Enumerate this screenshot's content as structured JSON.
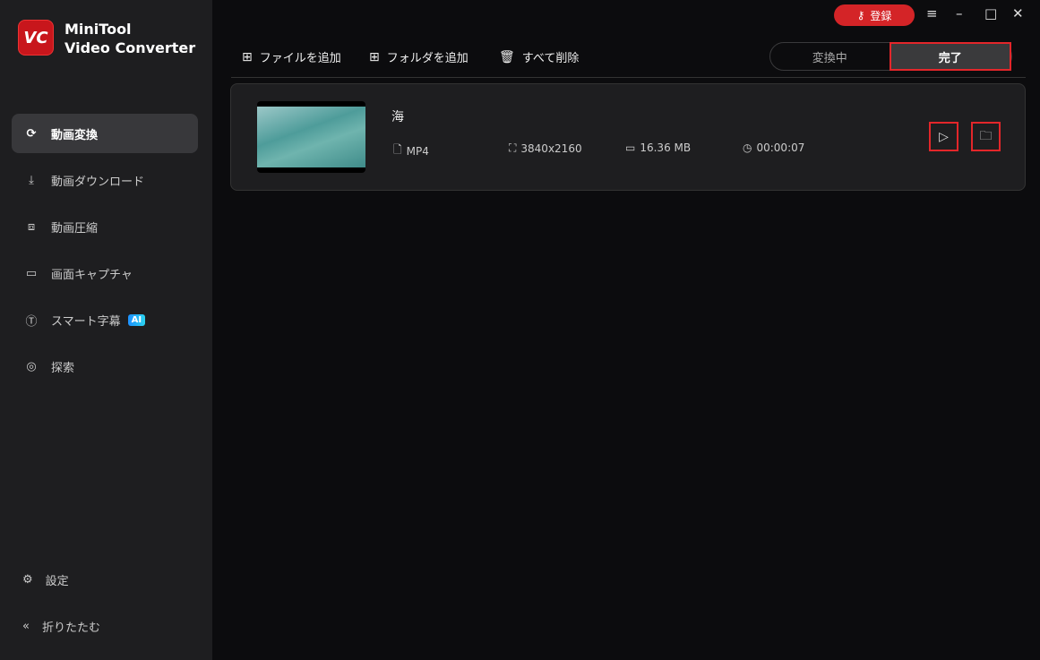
{
  "app": {
    "logo": "VC",
    "name_line1": "MiniTool",
    "name_line2": "Video Converter"
  },
  "sidebar": {
    "items": [
      {
        "label": "動画変換",
        "icon": "convert-icon"
      },
      {
        "label": "動画ダウンロード",
        "icon": "download-icon"
      },
      {
        "label": "動画圧縮",
        "icon": "compress-icon"
      },
      {
        "label": "画面キャプチャ",
        "icon": "camera-icon"
      },
      {
        "label": "スマート字幕",
        "icon": "subtitle-icon",
        "badge": "AI"
      },
      {
        "label": "探索",
        "icon": "compass-icon"
      }
    ],
    "settings": "設定",
    "collapse": "折りたたむ"
  },
  "titlebar": {
    "register": "登録"
  },
  "toolbar": {
    "add_file": "ファイルを追加",
    "add_folder": "フォルダを追加",
    "delete_all": "すべて削除"
  },
  "tabs": {
    "converting": "変換中",
    "done": "完了"
  },
  "file": {
    "name": "海",
    "format": "MP4",
    "resolution": "3840x2160",
    "size": "16.36 MB",
    "duration": "00:00:07"
  }
}
